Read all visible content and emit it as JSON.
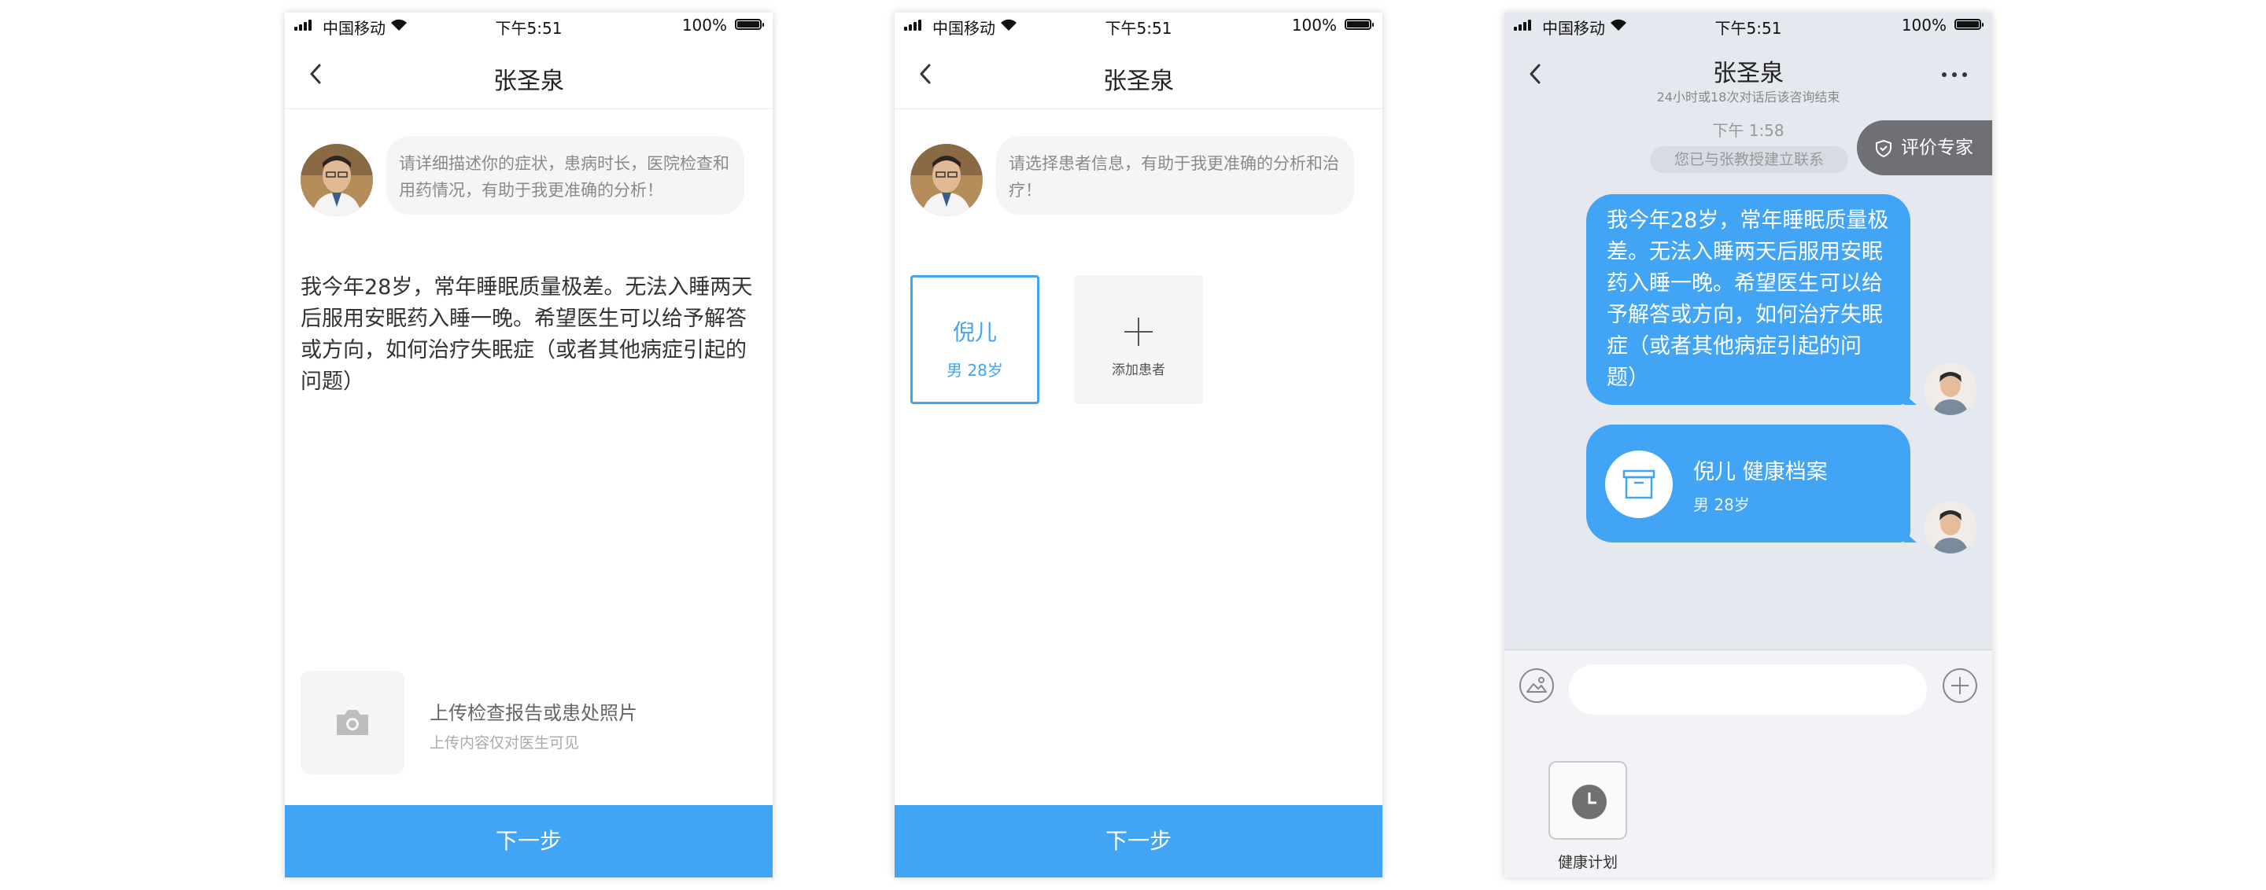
{
  "status": {
    "carrier": "中国移动",
    "time": "下午5:51",
    "battery": "100%"
  },
  "screen1": {
    "title": "张圣泉",
    "prompt": "请详细描述你的症状，患病时长，医院检查和用药情况，有助于我更准确的分析！",
    "message": "我今年28岁，常年睡眠质量极差。无法入睡两天后服用安眠药入睡一晚。希望医生可以给予解答或方向，如何治疗失眠症（或者其他病症引起的问题）",
    "upload_title": "上传检查报告或患处照片",
    "upload_subtitle": "上传内容仅对医生可见",
    "next_label": "下一步"
  },
  "screen2": {
    "title": "张圣泉",
    "prompt": "请选择患者信息，有助于我更准确的分析和治疗！",
    "patient": {
      "name": "倪儿",
      "info": "男 28岁"
    },
    "add_label": "添加患者",
    "next_label": "下一步"
  },
  "screen3": {
    "title": "张圣泉",
    "subtitle": "24小时或18次对话后该咨询结束",
    "time": "下午 1:58",
    "system_note": "您已与张教授建立联系",
    "rate_label": "评价专家",
    "message": "我今年28岁，常年睡眠质量极差。无法入睡两天后服用安眠药入睡一晚。希望医生可以给予解答或方向，如何治疗失眠症（或者其他病症引起的问题）",
    "record": {
      "title": "倪儿 健康档案",
      "info": "男 28岁"
    },
    "input_placeholder": "",
    "tray": [
      {
        "label": "健康计划",
        "icon": "clock-icon"
      }
    ]
  },
  "colors": {
    "accent": "#42a4f5",
    "chat_background": "#e6e8ef",
    "rate_button": "#6f7075"
  }
}
